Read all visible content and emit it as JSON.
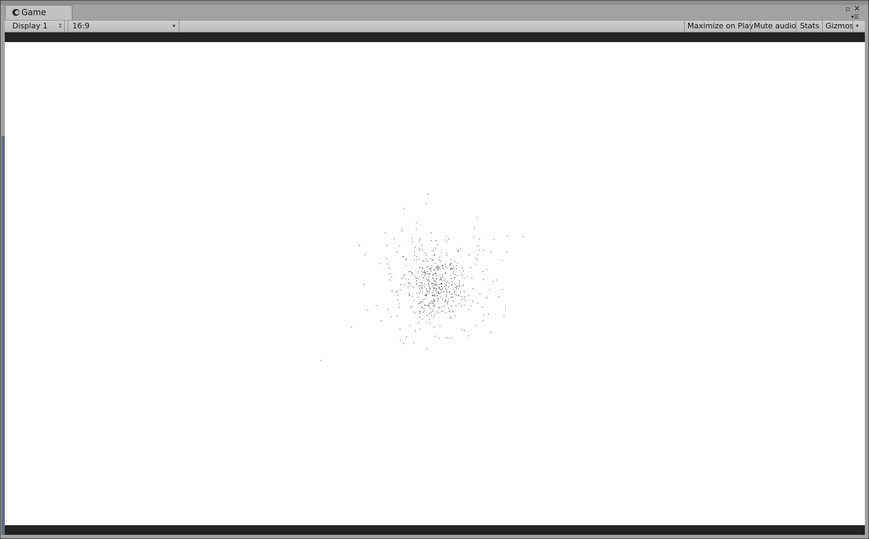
{
  "window": {
    "tab_title": "Game",
    "tab_icon": "unity-logo-icon",
    "maximize_glyph": "▫",
    "close_glyph": "✕",
    "menu_glyph": "▾☰"
  },
  "toolbar": {
    "display_select": "Display 1",
    "display_arrow": "⇕",
    "aspect_select": "16:9",
    "aspect_arrow": "▾",
    "maximize_on_play": "Maximize on Play",
    "mute_audio": "Mute audio",
    "stats": "Stats",
    "gizmos": "Gizmos",
    "gizmos_arrow": "▾"
  },
  "scene": {
    "background_color": "#ffffff",
    "particle_color": "#1a1a1a",
    "particle_count": 520
  }
}
